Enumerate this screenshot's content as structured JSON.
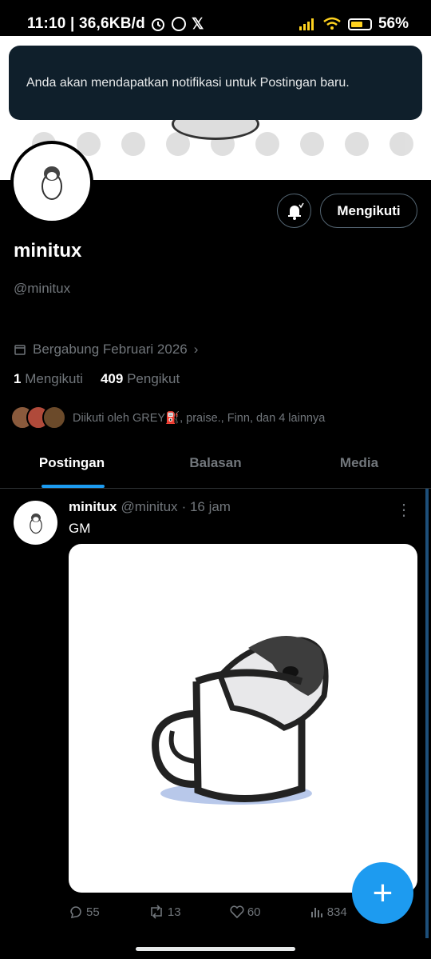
{
  "status_bar": {
    "time_net": "11:10 | 36,6KB/d",
    "battery": "56%"
  },
  "toast": {
    "message": "Anda akan mendapatkan notifikasi untuk Postingan baru."
  },
  "profile": {
    "display_name": "minitux",
    "handle": "@minitux",
    "follow_button": "Mengikuti",
    "joined": "Bergabung Februari 2026",
    "following_count": "1",
    "following_label": "Mengikuti",
    "followers_count": "409",
    "followers_label": "Pengikut",
    "followed_by": "Diikuti oleh GREY⛽️, praise., Finn, dan 4 lainnya"
  },
  "tabs": [
    {
      "label": "Postingan"
    },
    {
      "label": "Balasan"
    },
    {
      "label": "Media"
    }
  ],
  "post": {
    "name": "minitux",
    "handle": "@minitux",
    "time": "· 16 jam",
    "text": "GM",
    "replies": "55",
    "reposts": "13",
    "likes": "60",
    "views": "834"
  },
  "colors": {
    "accent": "#1d9bf0",
    "toast_bg": "#0f1f2b"
  }
}
